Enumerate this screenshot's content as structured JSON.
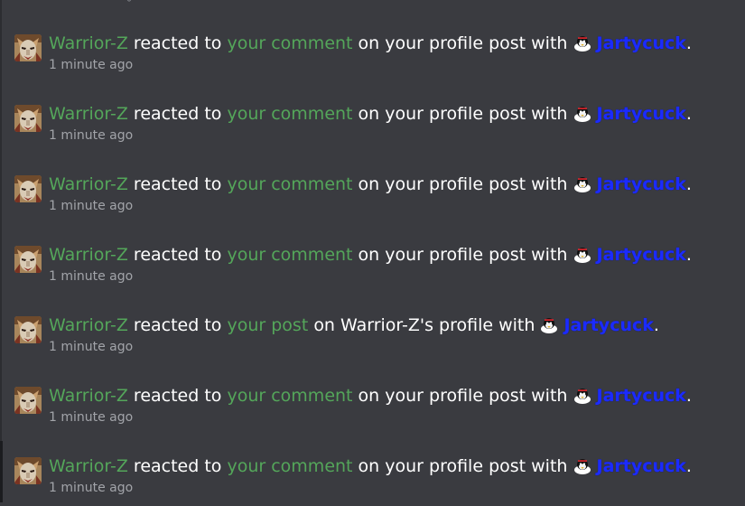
{
  "top_partial_text": "°",
  "alerts": [
    {
      "user": "Warrior-Z",
      "verb": "reacted to",
      "target": "your comment",
      "rest": "on your profile post with",
      "reaction_icon": "penguin-face-icon",
      "reaction": "Jartycuck",
      "end": ".",
      "time": "1 minute ago"
    },
    {
      "user": "Warrior-Z",
      "verb": "reacted to",
      "target": "your comment",
      "rest": "on your profile post with",
      "reaction_icon": "penguin-face-icon",
      "reaction": "Jartycuck",
      "end": ".",
      "time": "1 minute ago"
    },
    {
      "user": "Warrior-Z",
      "verb": "reacted to",
      "target": "your comment",
      "rest": "on your profile post with",
      "reaction_icon": "penguin-face-icon",
      "reaction": "Jartycuck",
      "end": ".",
      "time": "1 minute ago"
    },
    {
      "user": "Warrior-Z",
      "verb": "reacted to",
      "target": "your comment",
      "rest": "on your profile post with",
      "reaction_icon": "penguin-face-icon",
      "reaction": "Jartycuck",
      "end": ".",
      "time": "1 minute ago"
    },
    {
      "user": "Warrior-Z",
      "verb": "reacted to",
      "target": "your post",
      "rest": "on Warrior-Z's profile with",
      "reaction_icon": "penguin-face-icon",
      "reaction": "Jartycuck",
      "end": ".",
      "time": "1 minute ago"
    },
    {
      "user": "Warrior-Z",
      "verb": "reacted to",
      "target": "your comment",
      "rest": "on your profile post with",
      "reaction_icon": "penguin-face-icon",
      "reaction": "Jartycuck",
      "end": ".",
      "time": "1 minute ago"
    },
    {
      "user": "Warrior-Z",
      "verb": "reacted to",
      "target": "your comment",
      "rest": "on your profile post with",
      "reaction_icon": "penguin-face-icon",
      "reaction": "Jartycuck",
      "end": ".",
      "time": "1 minute ago"
    }
  ],
  "colors": {
    "background": "#3a3b40",
    "username": "#54a65a",
    "link": "#54a65a",
    "reaction": "#1b2bff",
    "timestamp": "#a2a4a9",
    "text": "#ffffff"
  }
}
